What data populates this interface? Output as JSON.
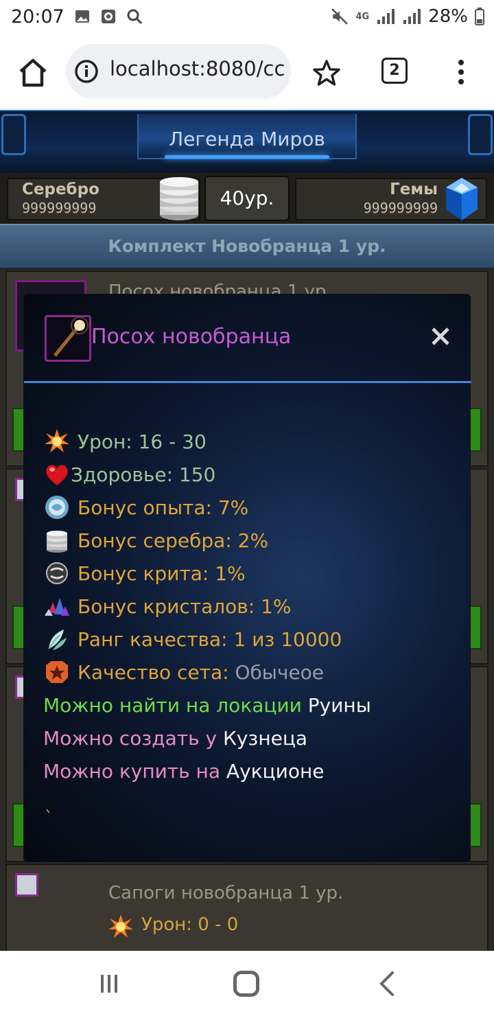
{
  "status_bar": {
    "time": "20:07",
    "network": "4G",
    "battery": "28%"
  },
  "browser": {
    "url": "localhost:8080/cc",
    "tab_count": "2"
  },
  "game": {
    "title": "Легенда Миров",
    "silver_label": "Серебро",
    "silver_value": "999999999",
    "level_label": "40ур.",
    "gems_label": "Гемы",
    "gems_value": "999999999",
    "set_title": "Комплект Новобранца 1 ур.",
    "first_item_name": "Посох новобранца 1 ур.",
    "last_item_name": "Сапоги новобранца 1 ур.",
    "last_item_stat": "Урон: 0 - 0"
  },
  "modal": {
    "title": "Посох новобранца",
    "stats": [
      {
        "icon": "explosion-icon",
        "text": "Урон: 16 - 30",
        "color": "#9dc49a"
      },
      {
        "icon": "heart-icon",
        "text": "Здоровье: 150",
        "color": "#9dc49a"
      },
      {
        "icon": "experience-orb-icon",
        "text": "Бонус опыта: 7%",
        "color": "#e0a538"
      },
      {
        "icon": "silver-coins-icon",
        "text": "Бонус серебра: 2%",
        "color": "#e0a538"
      },
      {
        "icon": "crit-icon",
        "text": "Бонус крита: 1%",
        "color": "#e0a538"
      },
      {
        "icon": "crystals-icon",
        "text": "Бонус кристалов: 1%",
        "color": "#e0a538"
      },
      {
        "icon": "leaf-rank-icon",
        "text": "Ранг качества: 1 из 10000",
        "color": "#e0a538"
      }
    ],
    "set_quality_label": "Качество сета: ",
    "set_quality_value": "Обычеое",
    "location_label": "Можно найти на локации ",
    "location_value": "Руины",
    "craft_label": "Можно создать у ",
    "craft_value": "Кузнеца",
    "buy_label": "Можно купить на ",
    "buy_value": "Аукционе",
    "footer_mark": "`"
  }
}
